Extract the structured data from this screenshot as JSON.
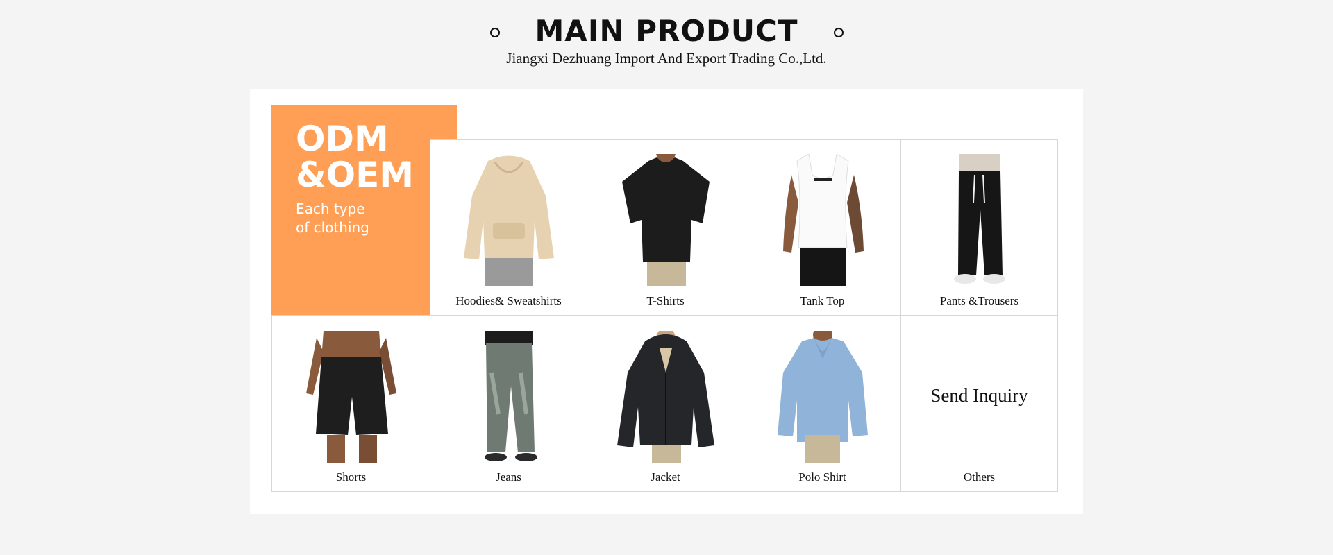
{
  "header": {
    "title": "MAIN PRODUCT",
    "subtitle": "Jiangxi Dezhuang Import And Export Trading Co.,Ltd."
  },
  "promo": {
    "line1": "ODM",
    "line2": "&OEM",
    "tag1": "Each type",
    "tag2": "of clothing",
    "color": "#ff9f55"
  },
  "products": {
    "hoodies": "Hoodies& Sweatshirts",
    "tshirts": "T-Shirts",
    "tanktop": "Tank Top",
    "pants": "Pants &Trousers",
    "shorts": "Shorts",
    "jeans": "Jeans",
    "jacket": "Jacket",
    "polo": "Polo Shirt",
    "others": "Others",
    "inquiry": "Send Inquiry"
  }
}
